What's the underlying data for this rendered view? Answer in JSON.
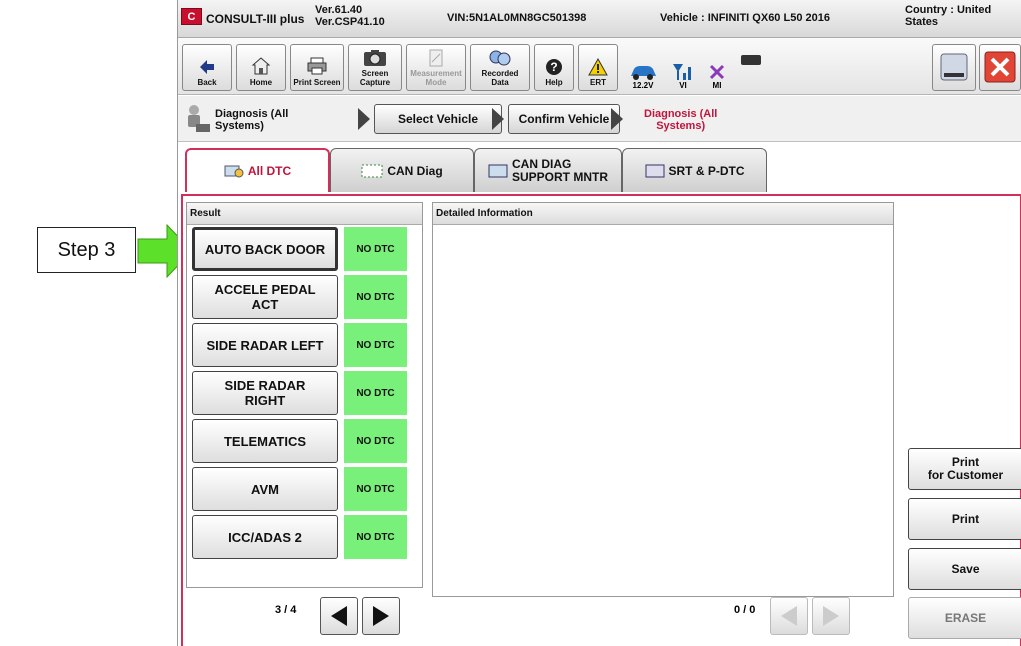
{
  "callout": {
    "label": "Step 3"
  },
  "titlebar": {
    "app_name": "CONSULT-III plus",
    "version1": "Ver.61.40",
    "version2": "Ver.CSP41.10",
    "vin": "VIN:5N1AL0MN8GC501398",
    "vehicle": "Vehicle : INFINITI QX60 L50 2016",
    "country1": "Country : United",
    "country2": "States"
  },
  "toolbar": {
    "back": "Back",
    "home": "Home",
    "print_screen": "Print Screen",
    "screen_capture1": "Screen",
    "screen_capture2": "Capture",
    "measurement1": "Measurement",
    "measurement2": "Mode",
    "recorded1": "Recorded",
    "recorded2": "Data",
    "help": "Help",
    "ert": "ERT",
    "voltage": "12.2V",
    "vi": "VI",
    "mi": "MI"
  },
  "breadcrumb": {
    "first1": "Diagnosis (All",
    "first2": "Systems)",
    "select_vehicle": "Select Vehicle",
    "confirm_vehicle": "Confirm Vehicle",
    "current1": "Diagnosis (All",
    "current2": "Systems)"
  },
  "tabs": {
    "all_dtc": "All DTC",
    "can_diag": "CAN Diag",
    "can_support1": "CAN DIAG",
    "can_support2": "SUPPORT MNTR",
    "srt": "SRT & P-DTC"
  },
  "result": {
    "header": "Result",
    "systems": [
      {
        "name1": "AUTO BACK DOOR",
        "name2": "",
        "status": "NO DTC"
      },
      {
        "name1": "ACCELE PEDAL",
        "name2": "ACT",
        "status": "NO DTC"
      },
      {
        "name1": "SIDE RADAR LEFT",
        "name2": "",
        "status": "NO DTC"
      },
      {
        "name1": "SIDE RADAR",
        "name2": "RIGHT",
        "status": "NO DTC"
      },
      {
        "name1": "TELEMATICS",
        "name2": "",
        "status": "NO DTC"
      },
      {
        "name1": "AVM",
        "name2": "",
        "status": "NO DTC"
      },
      {
        "name1": "ICC/ADAS 2",
        "name2": "",
        "status": "NO DTC"
      }
    ],
    "page": "3 / 4"
  },
  "detail": {
    "header": "Detailed Information",
    "page": "0 / 0"
  },
  "side": {
    "print_customer1": "Print",
    "print_customer2": "for Customer",
    "print": "Print",
    "save": "Save",
    "erase": "ERASE"
  },
  "colors": {
    "accent": "#d0305a",
    "dtc_ok": "#78f07a",
    "callout_arrow": "#5de02a"
  }
}
